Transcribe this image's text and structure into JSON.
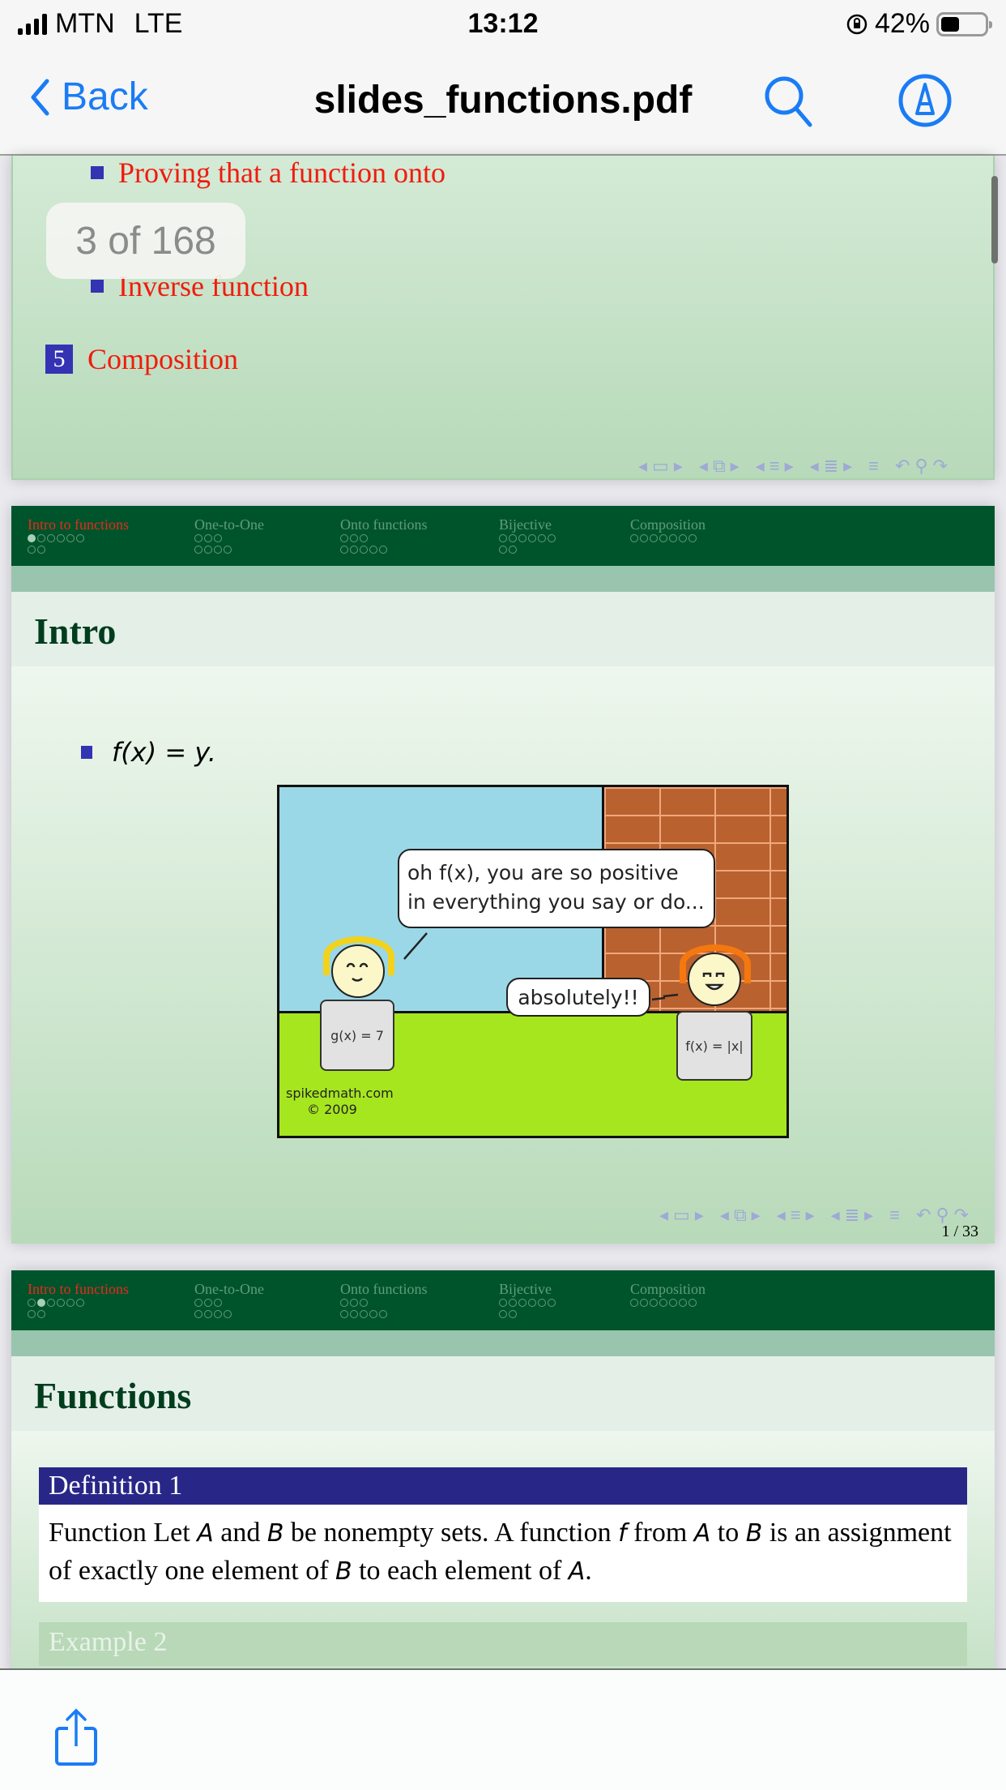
{
  "status_bar": {
    "carrier": "MTN",
    "network": "LTE",
    "time": "13:12",
    "battery_percent_text": "42%",
    "battery_level": 0.42,
    "orientation_lock_icon": "orientation-lock-icon"
  },
  "nav": {
    "back_label": "Back",
    "title": "slides_functions.pdf",
    "search_icon": "search-icon",
    "markup_icon": "markup-icon"
  },
  "page_indicator": "3 of 168",
  "slide1": {
    "items": [
      {
        "type": "subitem",
        "text": "Proving that a function onto"
      },
      {
        "type": "subitem",
        "text": "Inverse function"
      },
      {
        "type": "section",
        "number": "5",
        "text": "Composition"
      }
    ]
  },
  "beamer_header": {
    "sections": [
      {
        "name": "Intro to functions",
        "row1": 6,
        "row2": 2
      },
      {
        "name": "One-to-One",
        "row1": 3,
        "row2": 4
      },
      {
        "name": "Onto functions",
        "row1": 3,
        "row2": 5
      },
      {
        "name": "Bijective",
        "row1": 6,
        "row2": 2
      },
      {
        "name": "Composition",
        "row1": 7,
        "row2": 0
      }
    ]
  },
  "slide2": {
    "active_section": 0,
    "active_dot": 0,
    "title": "Intro",
    "bullet": "f(x) = y.",
    "comic": {
      "speech1_line1": "oh f(x), you are so positive",
      "speech1_line2": "in everything you say or do...",
      "speech2": "absolutely!!",
      "sign_left": "g(x) = 7",
      "sign_right": "f(x) = |x|",
      "credit_line1": "spikedmath.com",
      "credit_line2": "© 2009"
    },
    "page_number": "1 / 33"
  },
  "slide3": {
    "active_section": 0,
    "active_dot": 1,
    "title": "Functions",
    "definition_title": "Definition 1",
    "definition_parts": [
      "Function Let ",
      "A",
      " and ",
      "B",
      " be nonempty sets.  A function ",
      "f",
      " from ",
      "A",
      " to ",
      "B",
      " is an assignment of exactly one element of ",
      "B",
      " to each element of ",
      "A",
      "."
    ],
    "example_title": "Example 2"
  },
  "toolbar": {
    "share_icon": "share-icon"
  },
  "colors": {
    "ios_blue": "#1a7cf5",
    "beamer_dark_green": "#00542b",
    "beamer_red": "#e52b1e",
    "bullet_blue": "#3333b3",
    "block_title_blue": "#282788"
  }
}
